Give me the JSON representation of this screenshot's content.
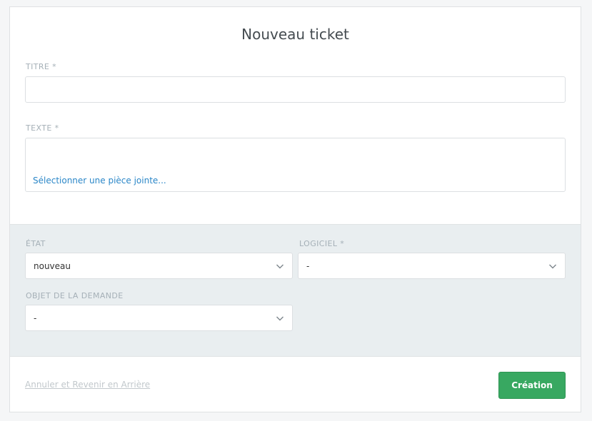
{
  "form": {
    "title": "Nouveau ticket",
    "titre_label": "TITRE *",
    "titre_value": "",
    "texte_label": "TEXTE *",
    "texte_value": "",
    "attachment_link": "Sélectionner une pièce jointe..."
  },
  "attributes": {
    "etat_label": "ÉTAT",
    "etat_value": "nouveau",
    "logiciel_label": "LOGICIEL *",
    "logiciel_value": "-",
    "objet_label": "OBJET DE LA DEMANDE",
    "objet_value": "-"
  },
  "footer": {
    "cancel_label": "Annuler et Revenir en Arrière",
    "create_label": "Création"
  },
  "colors": {
    "primary_button": "#38a861",
    "link": "#2b87c8",
    "section_bg": "#e9eef0"
  },
  "icons": {
    "select_arrow": "chevron-down-icon"
  }
}
